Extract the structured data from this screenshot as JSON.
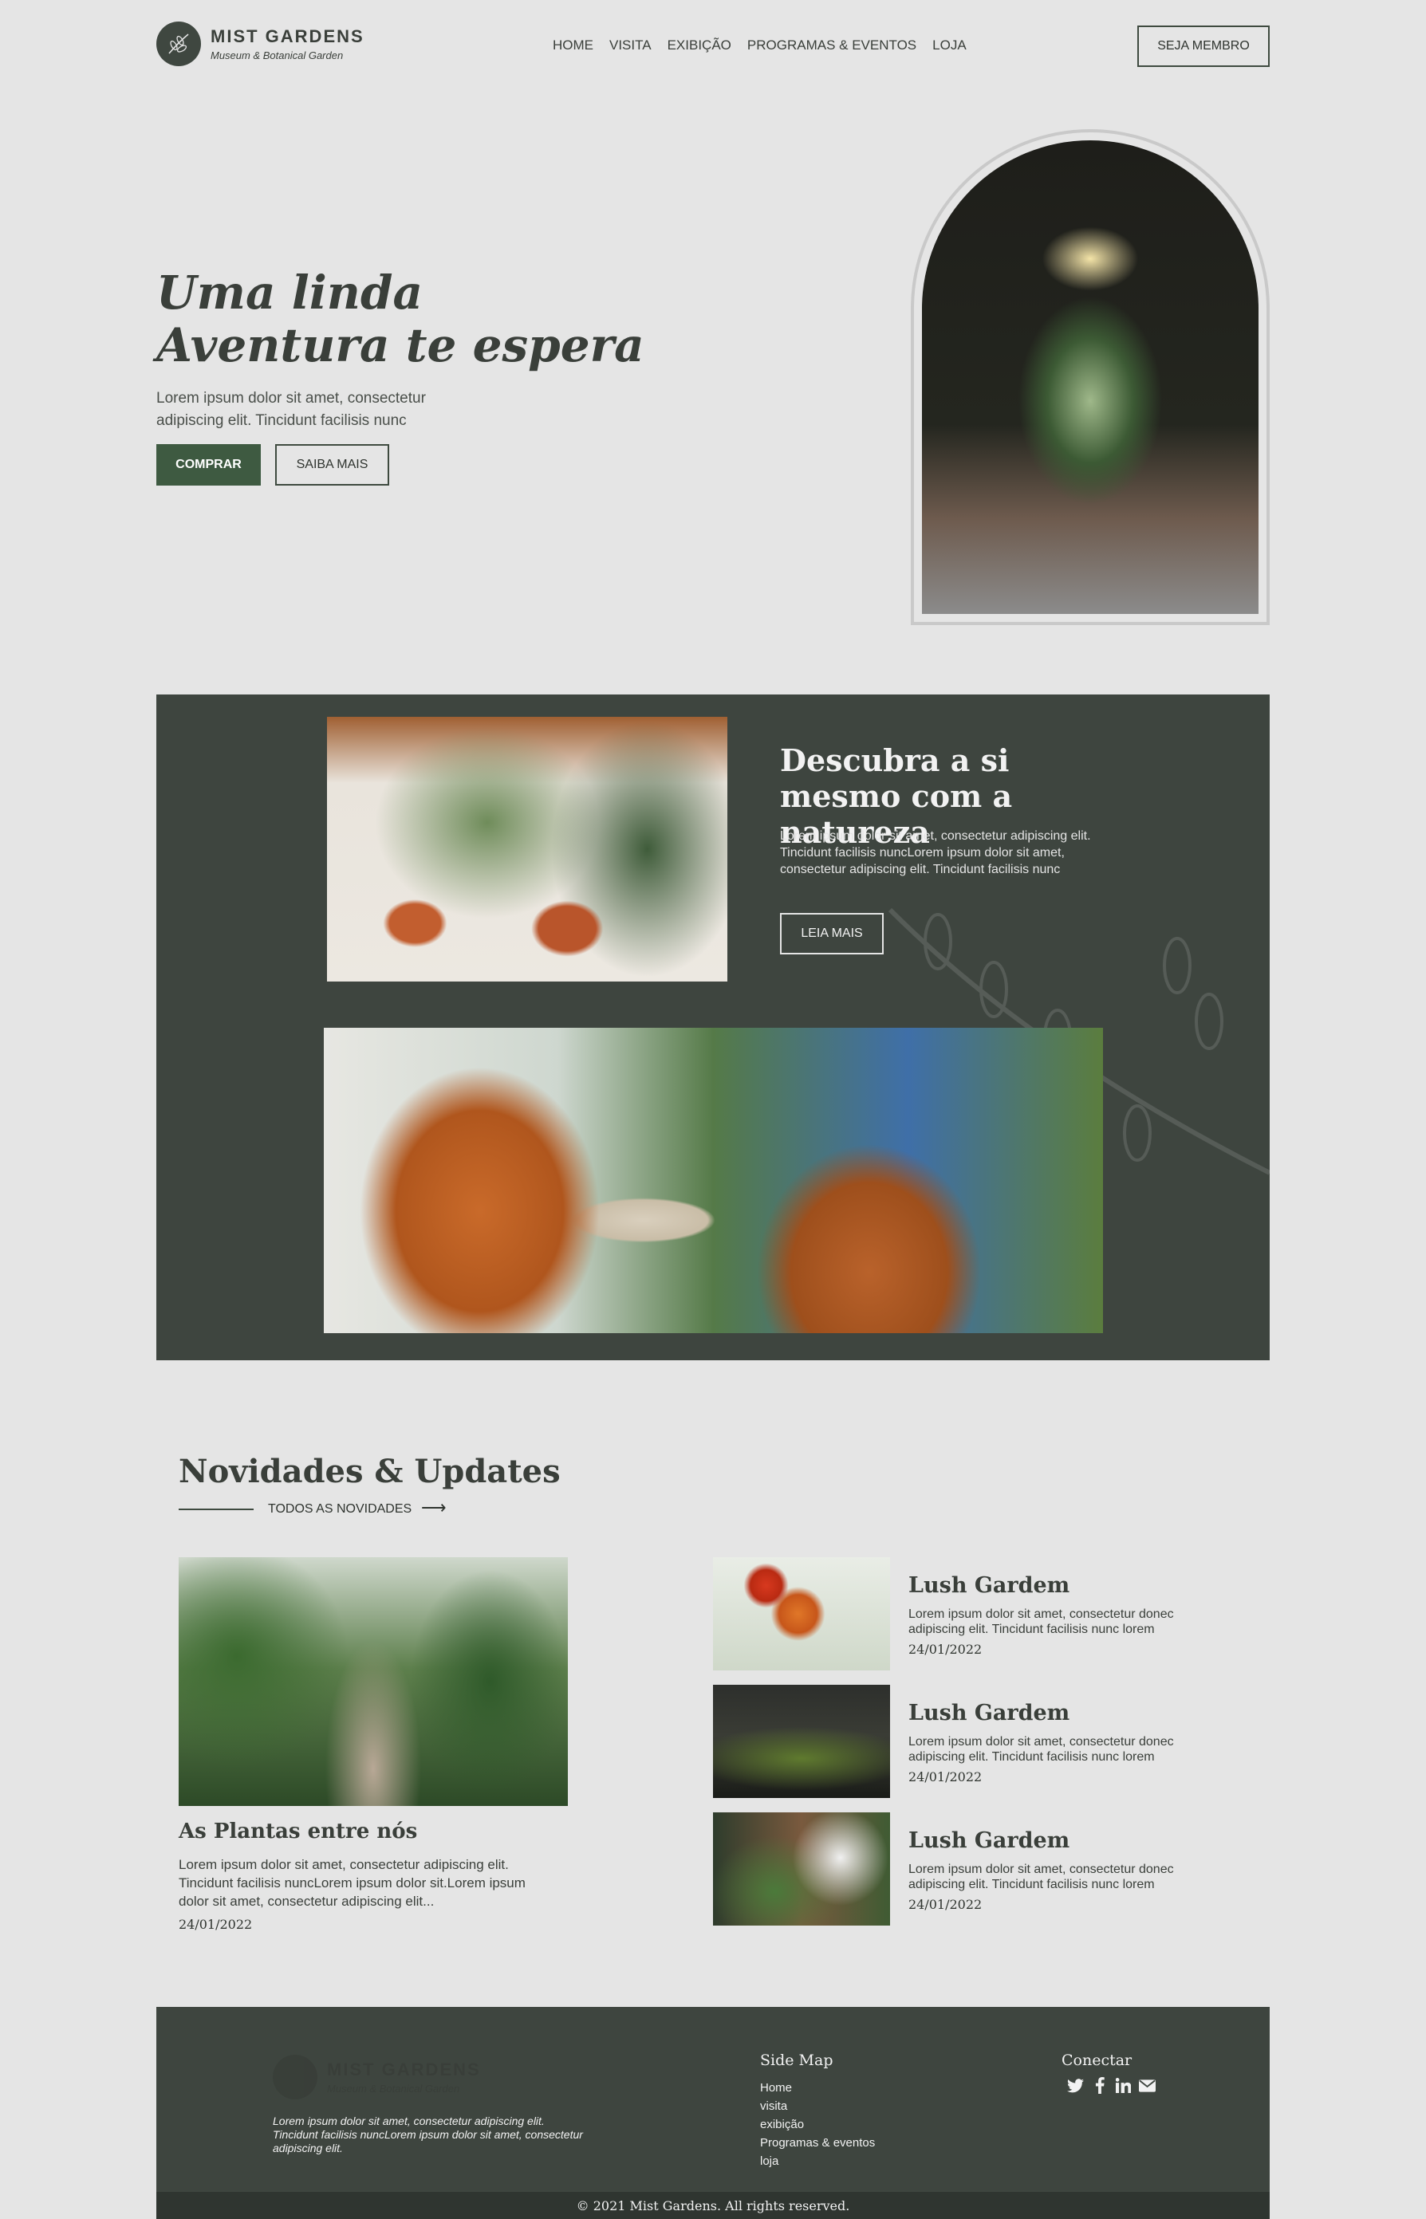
{
  "header": {
    "logo_title": "MIST GARDENS",
    "logo_subtitle": "Museum & Botanical Garden",
    "nav": [
      "HOME",
      "VISITA",
      "EXIBIÇÃO",
      "PROGRAMAS & EVENTOS",
      "LOJA"
    ],
    "member_button": "SEJA MEMBRO"
  },
  "hero": {
    "title_line1": "Uma linda",
    "title_line2": "Aventura te espera",
    "text": "Lorem ipsum dolor sit amet, consectetur adipiscing elit. Tincidunt facilisis nunc",
    "buy_button": "COMPRAR",
    "more_button": "SAIBA MAIS"
  },
  "feature": {
    "title": "Descubra a si mesmo com a natureza",
    "text": "Lorem ipsum dolor sit amet, consectetur adipiscing elit. Tincidunt facilisis nuncLorem ipsum dolor sit amet, consectetur adipiscing elit. Tincidunt facilisis nunc",
    "button": "LEIA MAIS"
  },
  "news": {
    "title": "Novidades & Updates",
    "all_link": "TODOS AS NOVIDADES",
    "featured": {
      "title": "As Plantas entre nós",
      "text": "Lorem ipsum dolor sit amet, consectetur adipiscing elit. Tincidunt facilisis nuncLorem ipsum dolor sit.Lorem ipsum dolor sit amet, consectetur adipiscing elit...",
      "date": "24/01/2022"
    },
    "items": [
      {
        "title": "Lush Gardem",
        "text": "Lorem ipsum dolor sit amet, consectetur donec adipiscing elit. Tincidunt facilisis nunc lorem",
        "date": "24/01/2022"
      },
      {
        "title": "Lush Gardem",
        "text": "Lorem ipsum dolor sit amet, consectetur donec adipiscing elit. Tincidunt facilisis nunc lorem",
        "date": "24/01/2022"
      },
      {
        "title": "Lush Gardem",
        "text": "Lorem ipsum dolor sit amet, consectetur donec adipiscing elit. Tincidunt facilisis nunc lorem",
        "date": "24/01/2022"
      }
    ]
  },
  "footer": {
    "logo_title": "MIST GARDENS",
    "logo_subtitle": "Museum & Botanical Garden",
    "text": "Lorem ipsum dolor sit amet, consectetur adipiscing elit. Tincidunt facilisis nuncLorem ipsum dolor sit amet, consectetur adipiscing elit.",
    "sitemap_title": "Side Map",
    "sitemap_links": [
      "Home",
      "visita",
      "exibição",
      "Programas & eventos",
      "loja"
    ],
    "connect_title": "Conectar",
    "social_icons": [
      "twitter-icon",
      "facebook-icon",
      "linkedin-icon",
      "email-icon"
    ],
    "copyright": "© 2021 Mist Gardens. All rights reserved."
  },
  "colors": {
    "background": "#e5e5e5",
    "dark_green": "#3e453f",
    "accent_green": "#3e5a41"
  }
}
